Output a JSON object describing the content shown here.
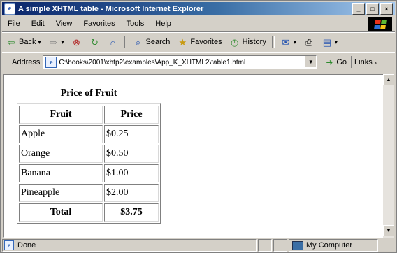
{
  "window": {
    "title": "A simple XHTML table - Microsoft Internet Explorer"
  },
  "window_controls": {
    "minimize": "_",
    "maximize": "□",
    "close": "×"
  },
  "menu": [
    "File",
    "Edit",
    "View",
    "Favorites",
    "Tools",
    "Help"
  ],
  "toolbar": {
    "back": "Back",
    "search": "Search",
    "favorites": "Favorites",
    "history": "History"
  },
  "address": {
    "label": "Address",
    "value": "C:\\books\\2001\\xhtp2\\examples\\App_K_XHTML2\\table1.html",
    "go": "Go",
    "links": "Links"
  },
  "table": {
    "caption": "Price of Fruit",
    "headers": [
      "Fruit",
      "Price"
    ],
    "rows": [
      [
        "Apple",
        "$0.25"
      ],
      [
        "Orange",
        "$0.50"
      ],
      [
        "Banana",
        "$1.00"
      ],
      [
        "Pineapple",
        "$2.00"
      ]
    ],
    "footer": [
      "Total",
      "$3.75"
    ]
  },
  "status": {
    "text": "Done",
    "zone": "My Computer"
  },
  "icons": {
    "app": "ie-logo-icon",
    "back": "back-arrow-icon",
    "forward": "forward-arrow-icon",
    "stop": "stop-icon",
    "refresh": "refresh-icon",
    "home": "home-icon",
    "search": "search-icon",
    "favorites": "favorites-icon",
    "history": "history-icon",
    "mail": "mail-icon",
    "print": "print-icon",
    "edit": "edit-icon",
    "go": "go-arrow-icon",
    "page": "page-icon",
    "computer": "computer-icon"
  }
}
